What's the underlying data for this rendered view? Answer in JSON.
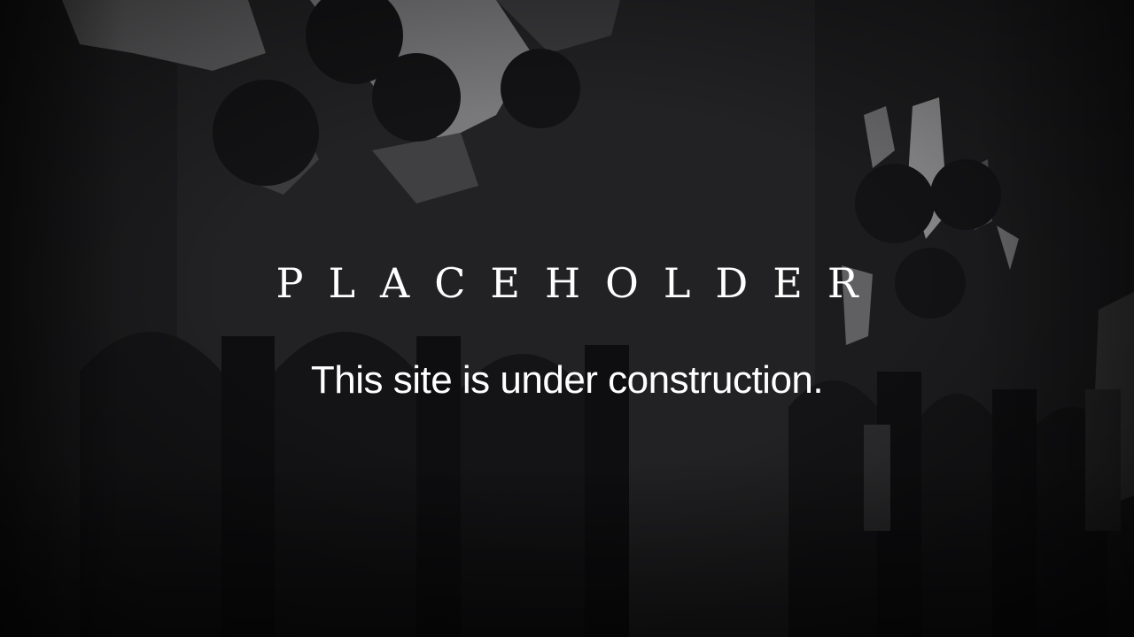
{
  "hero": {
    "title": "PLACEHOLDER",
    "subtitle": "This site is under construction."
  },
  "colors": {
    "background": "#1a1a1c",
    "text": "#ffffff",
    "silhouette": "#0f0f11",
    "sky": "#8a8a8c"
  }
}
